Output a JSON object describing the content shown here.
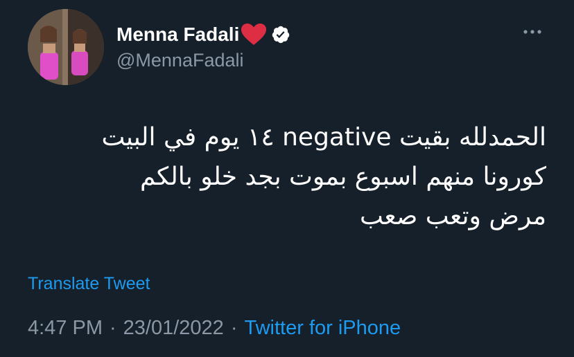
{
  "tweet": {
    "author": {
      "display_name": "Menna Fadali",
      "handle": "@MennaFadali",
      "name_emoji": "heart-icon",
      "verified": "verified-badge-icon"
    },
    "text_lines": [
      "الحمدلله بقيت negative ١٤ يوم في البيت",
      "كورونا منهم اسبوع بموت بجد خلو بالكم",
      "مرض وتعب صعب"
    ],
    "translate_label": "Translate Tweet",
    "time": "4:47 PM",
    "date": "23/01/2022",
    "separator": "·",
    "source": "Twitter for iPhone",
    "more_icon": "more-horizontal-icon"
  },
  "colors": {
    "background": "#15202b",
    "text_primary": "#ffffff",
    "text_secondary": "#8b98a5",
    "link": "#1d9bf0",
    "heart": "#dd2e44"
  }
}
